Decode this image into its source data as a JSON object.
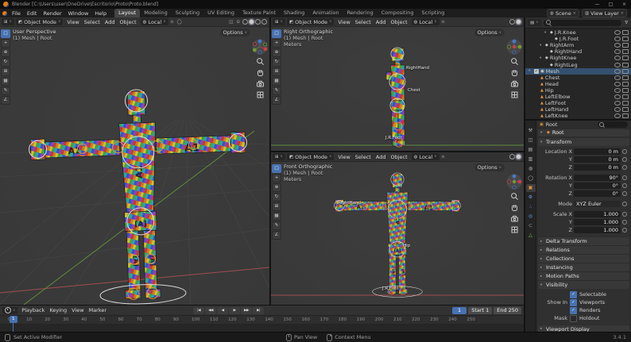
{
  "window": {
    "title": "Blender [C:\\Users\\user\\OneDrive\\Escritorio\\Proto\\Proto.blend]",
    "controls": {
      "minimize": "—",
      "maximize": "□",
      "close": "×"
    }
  },
  "icons": {
    "caret": "∨",
    "collapsed": "▸",
    "expanded": "▾",
    "magnet": "∩",
    "proportional": "◯",
    "filter": "∇",
    "check": "✓",
    "editor_grid": "⊞",
    "mode_glyph": "◩",
    "orientation_glyph": "◍",
    "outliner_glyph": "▤",
    "overlays": "◫",
    "xray": "⊙",
    "breadcrumb_glyph": "▣",
    "armature_glyph": "◆"
  },
  "colors": {
    "accent_blue": "#4772b3",
    "object_orange": "#e8913c",
    "axis_x_red": "#c4424e",
    "axis_y_green": "#6f9a35",
    "axis_z_blue": "#4a77c4"
  },
  "menubar": {
    "menus": [
      "File",
      "Edit",
      "Render",
      "Window",
      "Help"
    ],
    "workspaces": [
      {
        "label": "Layout",
        "cls": "active"
      },
      {
        "label": "Modeling"
      },
      {
        "label": "Sculpting"
      },
      {
        "label": "UV Editing"
      },
      {
        "label": "Texture Paint"
      },
      {
        "label": "Shading"
      },
      {
        "label": "Animation"
      },
      {
        "label": "Rendering"
      },
      {
        "label": "Compositing"
      },
      {
        "label": "Scripting"
      }
    ],
    "scene": "Scene",
    "view_layer": "View Layer"
  },
  "viewport_header": {
    "mode": "Object Mode",
    "menus": [
      "View",
      "Select",
      "Add",
      "Object"
    ],
    "orientation": "Local",
    "options": "Options"
  },
  "toolbar": {
    "tools": [
      {
        "glyph": "□",
        "cls": "active"
      },
      {
        "glyph": "+"
      },
      {
        "glyph": "⊕"
      },
      {
        "glyph": "↻"
      },
      {
        "glyph": "⊞"
      },
      {
        "glyph": "▦"
      },
      {
        "glyph": "✎"
      },
      {
        "glyph": "∠"
      }
    ]
  },
  "viewports": {
    "perspective": {
      "label": "User Perspective",
      "sublabel": "(1) Mesh | Root"
    },
    "side": {
      "label": "Right Orthographic",
      "sublabel": "(1) Mesh | Root",
      "units": "Meters",
      "bone_labels": [
        "RightHand",
        "Chest",
        "J.R.Foot"
      ]
    },
    "front": {
      "label": "Front Orthographic",
      "sublabel": "(1) Mesh | Root",
      "units": "Meters",
      "bone_labels": [
        "RightHand",
        "Hip",
        "J.R.Foot"
      ]
    }
  },
  "outliner": {
    "rows": [
      {
        "label": "J.R.Knee",
        "cls": "ind3 t-bone",
        "glyph": "◆",
        "arrow": "▾"
      },
      {
        "label": "J.R.Foot",
        "cls": "ind4 t-bone",
        "glyph": "◆",
        "arrow": ""
      },
      {
        "label": "RightArm",
        "cls": "ind2 t-bone",
        "glyph": "◆",
        "arrow": "▾"
      },
      {
        "label": "RightHand",
        "cls": "ind3 t-bone",
        "glyph": "◆",
        "arrow": ""
      },
      {
        "label": "RightKnee",
        "cls": "ind2 t-bone",
        "glyph": "◆",
        "arrow": "▾"
      },
      {
        "label": "RightLeg",
        "cls": "ind3 t-bone",
        "glyph": "◆",
        "arrow": ""
      },
      {
        "label": "Mesh",
        "cls": "ind0 t-col selected has-check",
        "glyph": "▣",
        "arrow": "▾"
      },
      {
        "label": "Chest",
        "cls": "ind1 t-mesh",
        "glyph": "▲",
        "arrow": ""
      },
      {
        "label": "Head",
        "cls": "ind1 t-mesh",
        "glyph": "▲",
        "arrow": ""
      },
      {
        "label": "Hip",
        "cls": "ind1 t-mesh",
        "glyph": "▲",
        "arrow": ""
      },
      {
        "label": "LeftElbow",
        "cls": "ind1 t-mesh",
        "glyph": "▲",
        "arrow": ""
      },
      {
        "label": "LeftFoot",
        "cls": "ind1 t-mesh",
        "glyph": "▲",
        "arrow": ""
      },
      {
        "label": "LeftHand",
        "cls": "ind1 t-mesh",
        "glyph": "▲",
        "arrow": ""
      },
      {
        "label": "LeftKnee",
        "cls": "ind1 t-mesh",
        "glyph": "▲",
        "arrow": ""
      }
    ]
  },
  "properties": {
    "tabs": [
      {
        "glyph": "⚒"
      },
      {
        "glyph": "◫"
      },
      {
        "glyph": "▤"
      },
      {
        "glyph": "▥"
      },
      {
        "glyph": "◍"
      },
      {
        "glyph": "◯"
      },
      {
        "glyph": "▣",
        "cls": "active c-or"
      },
      {
        "glyph": "⚙",
        "cls": "c-bl"
      },
      {
        "glyph": "∴",
        "cls": "c-bl"
      },
      {
        "glyph": "◎",
        "cls": "c-bl"
      },
      {
        "glyph": "⊂"
      },
      {
        "glyph": "△",
        "cls": "c-gr"
      }
    ],
    "breadcrumb": "Root",
    "name": "Root",
    "transform_title": "Transform",
    "transform_rows": [
      {
        "label": "Location X",
        "value": "0 m"
      },
      {
        "label": "Y",
        "value": "0 m"
      },
      {
        "label": "Z",
        "value": "0 m"
      },
      {
        "label": "Rotation X",
        "value": "90°",
        "cls": "gap"
      },
      {
        "label": "Y",
        "value": "0°"
      },
      {
        "label": "Z",
        "value": "0°"
      },
      {
        "label": "Mode",
        "value": "XYZ Euler",
        "cls": "gap drop"
      },
      {
        "label": "Scale X",
        "value": "1.000",
        "cls": "gap"
      },
      {
        "label": "Y",
        "value": "1.000"
      },
      {
        "label": "Z",
        "value": "1.000"
      }
    ],
    "collapsed_panels": [
      "Delta Transform",
      "Relations",
      "Collections",
      "Instancing",
      "Motion Paths"
    ],
    "visibility": {
      "title": "Visibility",
      "selectable": "Selectable",
      "show_in": "Show In",
      "viewports": "Viewports",
      "renders": "Renders",
      "mask": "Mask",
      "holdout": "Holdout"
    },
    "viewport_display": "Viewport Display"
  },
  "timeline": {
    "menus": [
      "Playback",
      "Keying",
      "View",
      "Marker"
    ],
    "controls": [
      "|◀",
      "◀◀",
      "◀",
      "▶",
      "▶▶",
      "▶|"
    ],
    "current": "1",
    "start_label": "Start",
    "start": "1",
    "end_label": "End",
    "end": "250",
    "ruler": [
      "0",
      "10",
      "20",
      "30",
      "40",
      "50",
      "60",
      "70",
      "80",
      "90",
      "100",
      "110",
      "120",
      "130",
      "140",
      "150",
      "160",
      "170",
      "180",
      "190",
      "200",
      "210",
      "220",
      "230",
      "240",
      "250"
    ]
  },
  "statusbar": {
    "left": "Set Active Modifier",
    "pan": "Pan View",
    "context": "Context Menu",
    "version": "3.4.1"
  }
}
